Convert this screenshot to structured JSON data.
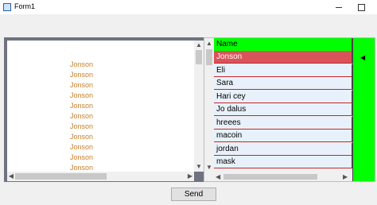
{
  "window": {
    "title": "Form1"
  },
  "listbox": {
    "items": [
      "Jonson",
      "Jonson",
      "Jonson",
      "Jonson",
      "Jonson",
      "Jonson",
      "Jonson",
      "Jonson",
      "Jonson",
      "Jonson",
      "Jonson"
    ]
  },
  "grid": {
    "header": "Name",
    "rows": [
      "Jonson",
      "Eli",
      "Sara",
      "Hari cey",
      "Jo dalus",
      "hreees",
      "macoin",
      "jordan",
      "mask"
    ],
    "selected_index": 0,
    "colors": {
      "header_bg": "#00ff00",
      "row_bg": "#e8f1fb",
      "row_border": "#c1272d",
      "selected_bg": "#d9545a",
      "item_text": "#c9812e"
    }
  },
  "buttons": {
    "send_label": "Send"
  },
  "icons": {
    "app": "form-window-icon",
    "row_marker": "triangle-left-icon"
  }
}
